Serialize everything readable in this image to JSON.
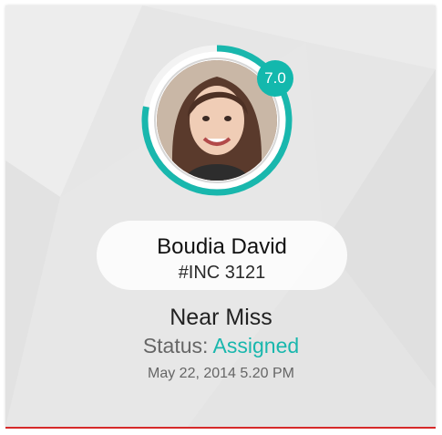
{
  "person": {
    "name": "Boudia David",
    "incident_id": "#INC 3121",
    "score": "7.0",
    "score_fraction": 0.78
  },
  "incident": {
    "type": "Near Miss",
    "status_label": "Status:",
    "status_value": "Assigned",
    "date": "May 22, 2014 5.20 PM"
  },
  "colors": {
    "accent_teal": "#19b7ad",
    "bottom_rule": "#d62a2a",
    "card_background": "#e6e6e6"
  },
  "icons": {
    "avatar": "avatar-photo",
    "score_ring": "progress-ring"
  }
}
